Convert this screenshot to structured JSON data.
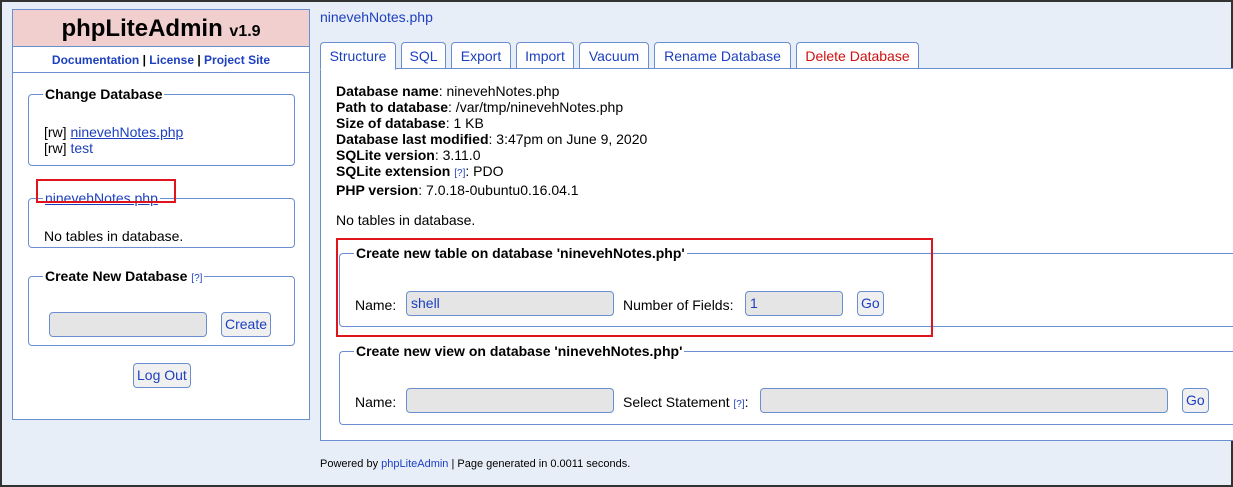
{
  "app": {
    "name": "phpLiteAdmin",
    "version": "v1.9"
  },
  "top_links": {
    "documentation": "Documentation",
    "sep1": "|",
    "license": "License",
    "sep2": "|",
    "project_site": "Project Site"
  },
  "change_database": {
    "legend": "Change Database",
    "items": [
      {
        "mode": "[rw]",
        "name": "ninevehNotes.php"
      },
      {
        "mode": "[rw]",
        "name": "test"
      }
    ]
  },
  "current_db_box": {
    "legend_link": "ninevehNotes.php",
    "message": "No tables in database."
  },
  "create_database": {
    "legend": "Create New Database",
    "help": "[?]",
    "input_value": "",
    "button": "Create"
  },
  "logout": "Log Out",
  "breadcrumb": "ninevehNotes.php",
  "tabs": [
    {
      "label": "Structure",
      "active": true
    },
    {
      "label": "SQL"
    },
    {
      "label": "Export"
    },
    {
      "label": "Import"
    },
    {
      "label": "Vacuum"
    },
    {
      "label": "Rename Database"
    },
    {
      "label": "Delete Database",
      "danger": true
    }
  ],
  "db_info": [
    {
      "label": "Database name",
      "value": ": ninevehNotes.php"
    },
    {
      "label": "Path to database",
      "value": ": /var/tmp/ninevehNotes.php"
    },
    {
      "label": "Size of database",
      "value": ": 1 KB"
    },
    {
      "label": "Database last modified",
      "value": ": 3:47pm on June 9, 2020"
    },
    {
      "label": "SQLite version",
      "value": ": 3.11.0"
    },
    {
      "label": "SQLite extension",
      "help": "[?]",
      "value": ": PDO"
    },
    {
      "label": "PHP version",
      "value": ": 7.0.18-0ubuntu0.16.04.1"
    }
  ],
  "main_message": "No tables in database.",
  "create_table": {
    "legend": "Create new table on database 'ninevehNotes.php'",
    "name_label": "Name:",
    "name_value": "shell",
    "fields_label": "Number of Fields:",
    "fields_value": "1",
    "button": "Go"
  },
  "create_view": {
    "legend": "Create new view on database 'ninevehNotes.php'",
    "name_label": "Name:",
    "name_value": "",
    "statement_label": "Select Statement",
    "statement_help": "[?]",
    "statement_label_suffix": ":",
    "statement_value": "",
    "button": "Go"
  },
  "footer": {
    "prefix": "Powered by",
    "link": "phpLiteAdmin",
    "suffix": "| Page generated in 0.0011 seconds."
  },
  "colors": {
    "link": "#1c3fc0",
    "border": "#6a8fd0",
    "logo_bg": "#f2cfcf",
    "page_bg": "#e8eef8",
    "danger": "#d01010",
    "highlight": "#e0141c"
  }
}
